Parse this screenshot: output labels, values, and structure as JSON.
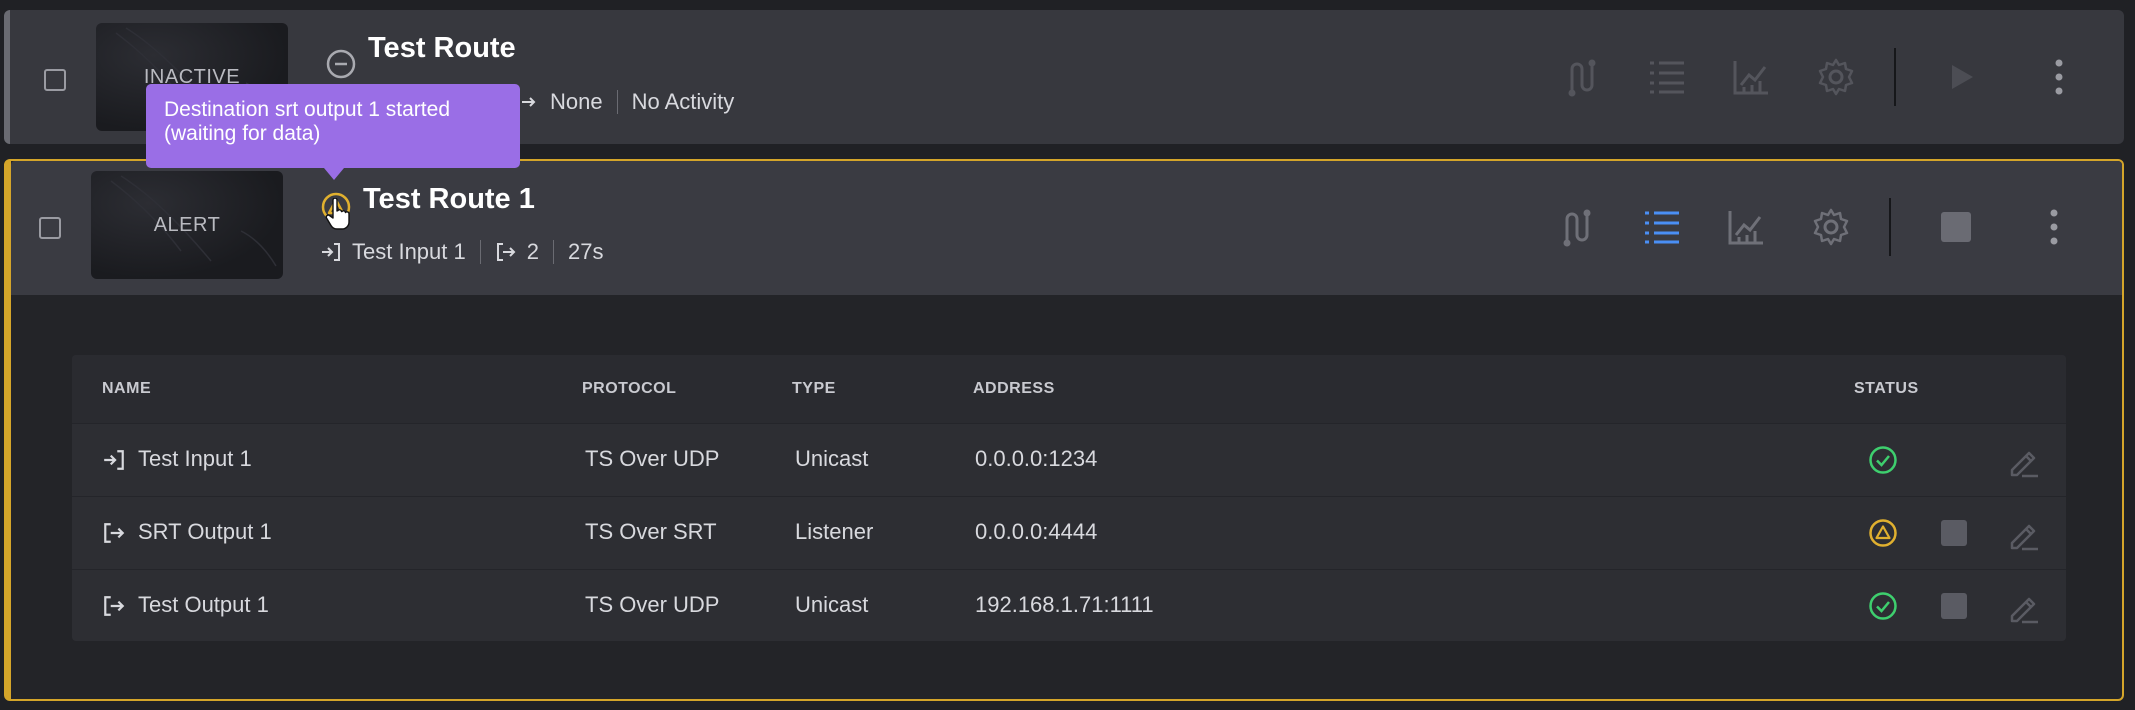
{
  "routes": [
    {
      "title": "Test Route",
      "thumbnail_label": "INACTIVE",
      "status": "inactive",
      "meta": {
        "destinations": "None",
        "activity": "No Activity"
      },
      "play_icon": "play-icon"
    },
    {
      "title": "Test Route 1",
      "thumbnail_label": "ALERT",
      "status": "alert",
      "meta": {
        "input": "Test Input 1",
        "output_count": "2",
        "uptime": "27s"
      },
      "stop_icon": "stop-icon"
    }
  ],
  "tooltip": {
    "text": "Destination srt output 1 started (waiting for data)"
  },
  "action_icons": [
    "route-icon",
    "list-icon",
    "chart-icon",
    "gear-icon",
    "more-icon"
  ],
  "colors": {
    "alert": "#d4a52a",
    "ok": "#3ecf6e",
    "active_icon": "#4a8ff5",
    "tooltip": "#9a6ee6"
  },
  "table": {
    "headers": {
      "name": "NAME",
      "protocol": "PROTOCOL",
      "type": "TYPE",
      "address": "ADDRESS",
      "status": "STATUS"
    },
    "rows": [
      {
        "kind": "input",
        "name": "Test Input 1",
        "protocol": "TS Over UDP",
        "type": "Unicast",
        "address": "0.0.0.0:1234",
        "status": "ok"
      },
      {
        "kind": "output",
        "name": "SRT Output 1",
        "protocol": "TS Over SRT",
        "type": "Listener",
        "address": "0.0.0.0:4444",
        "status": "warning"
      },
      {
        "kind": "output",
        "name": "Test Output 1",
        "protocol": "TS Over UDP",
        "type": "Unicast",
        "address": "192.168.1.71:1111",
        "status": "ok"
      }
    ]
  }
}
